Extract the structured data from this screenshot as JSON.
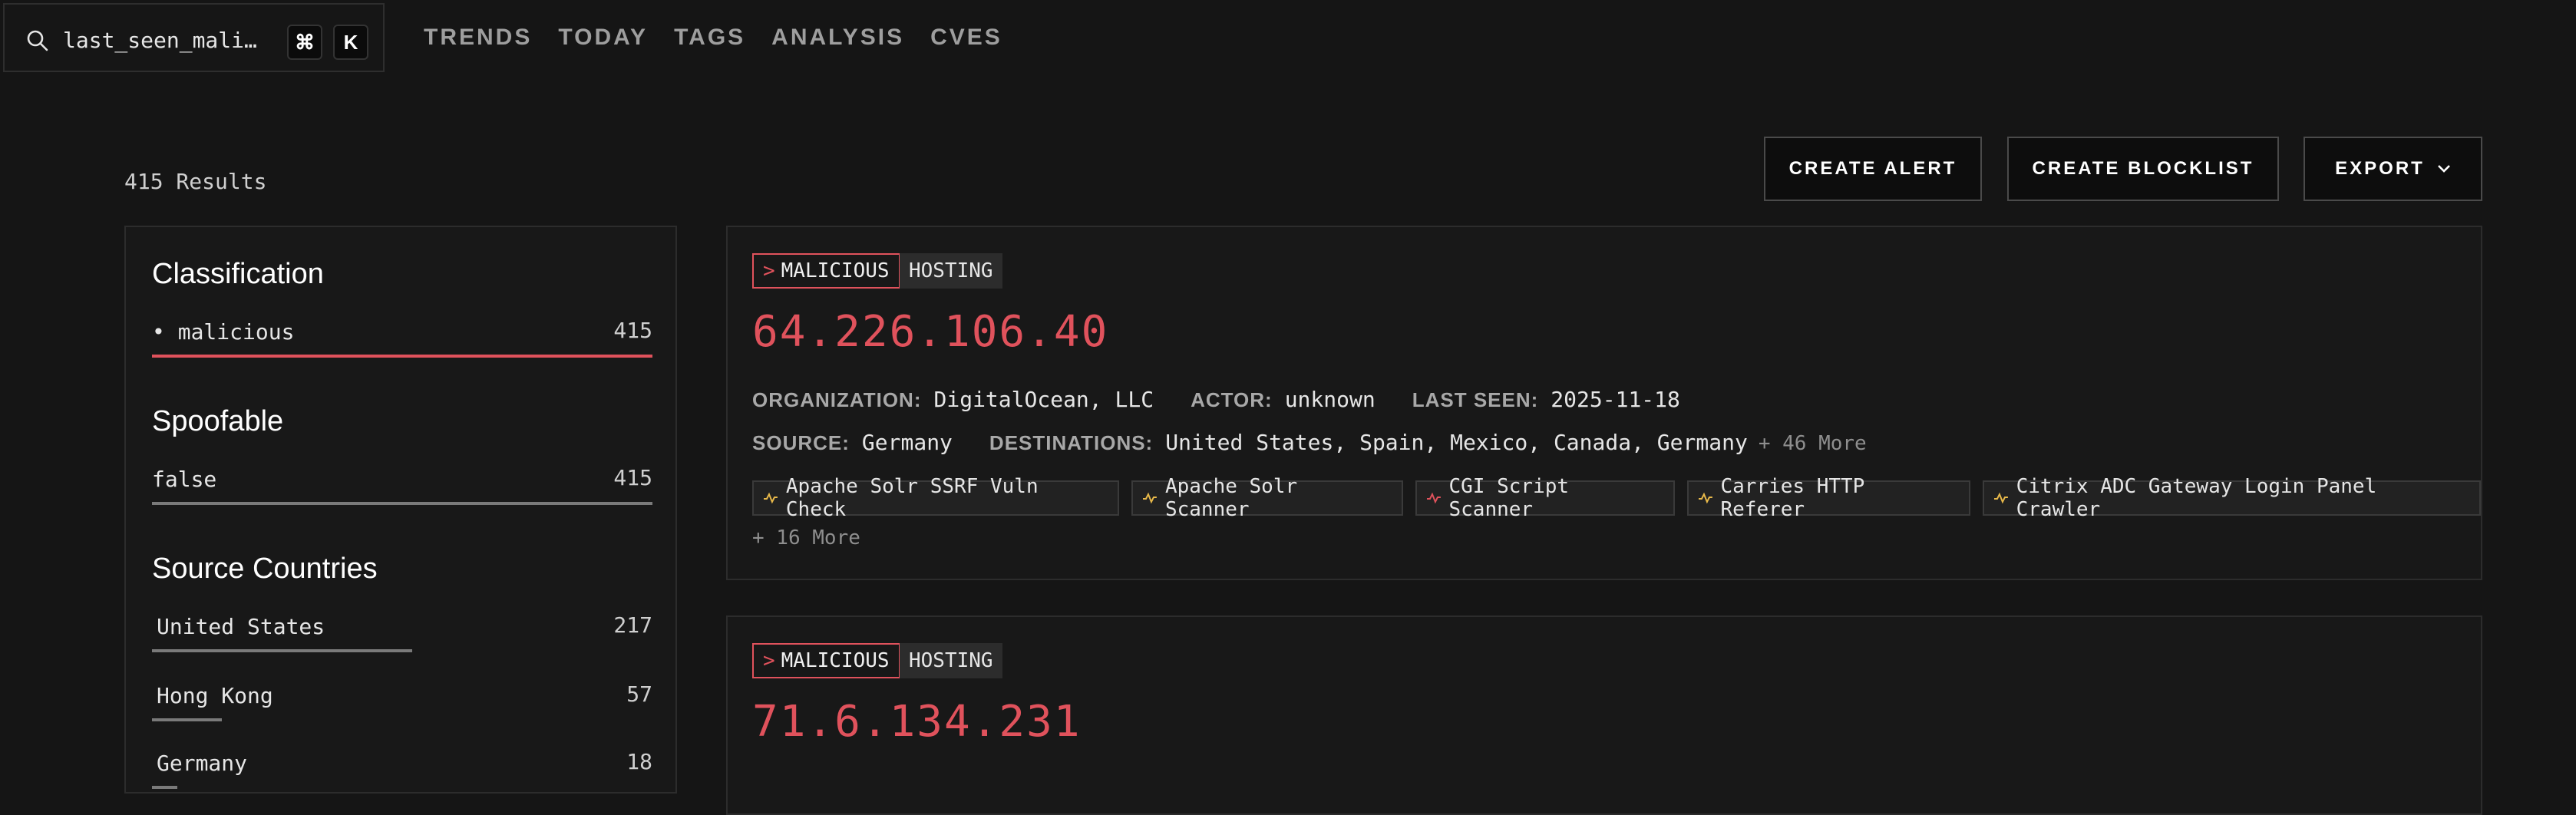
{
  "search": {
    "query": "last_seen_mali…",
    "shortcut_cmd": "⌘",
    "shortcut_key": "K"
  },
  "nav": [
    "TRENDS",
    "TODAY",
    "TAGS",
    "ANALYSIS",
    "CVES"
  ],
  "results_count": "415 Results",
  "actions": {
    "create_alert": "CREATE ALERT",
    "create_blocklist": "CREATE BLOCKLIST",
    "export": "EXPORT"
  },
  "sidebar": {
    "classification": {
      "title": "Classification",
      "items": [
        {
          "label": "malicious",
          "count": "415",
          "fraction": 1.0
        }
      ]
    },
    "spoofable": {
      "title": "Spoofable",
      "items": [
        {
          "label": "false",
          "count": "415",
          "fraction": 1.0
        }
      ]
    },
    "countries": {
      "title": "Source Countries",
      "items": [
        {
          "label": "United States",
          "count": "217",
          "fraction": 0.52
        },
        {
          "label": "Hong Kong",
          "count": "57",
          "fraction": 0.14
        },
        {
          "label": "Germany",
          "count": "18",
          "fraction": 0.05
        }
      ]
    }
  },
  "cards": [
    {
      "classification": "MALICIOUS",
      "category": "HOSTING",
      "ip": "64.226.106.40",
      "organization_label": "ORGANIZATION:",
      "organization": "DigitalOcean, LLC",
      "actor_label": "ACTOR:",
      "actor": "unknown",
      "last_seen_label": "LAST SEEN:",
      "last_seen": "2025-11-18",
      "source_label": "SOURCE:",
      "source": "Germany",
      "destinations_label": "DESTINATIONS:",
      "destinations": "United States, Spain, Mexico, Canada, Germany",
      "destinations_more": "+ 46 More",
      "tags": [
        {
          "label": "Apache Solr SSRF Vuln Check",
          "color": "#e8b94a"
        },
        {
          "label": "Apache Solr Scanner",
          "color": "#e8b94a"
        },
        {
          "label": "CGI Script Scanner",
          "color": "#e0525c"
        },
        {
          "label": "Carries HTTP Referer",
          "color": "#e8b94a"
        },
        {
          "label": "Citrix ADC Gateway Login Panel Crawler",
          "color": "#e8b94a"
        }
      ],
      "tags_more": "+ 16 More"
    },
    {
      "classification": "MALICIOUS",
      "category": "HOSTING",
      "ip": "71.6.134.231"
    }
  ],
  "colors": {
    "accent": "#e0525c",
    "background": "#151515",
    "panel": "#181818",
    "warning": "#e8b94a"
  }
}
